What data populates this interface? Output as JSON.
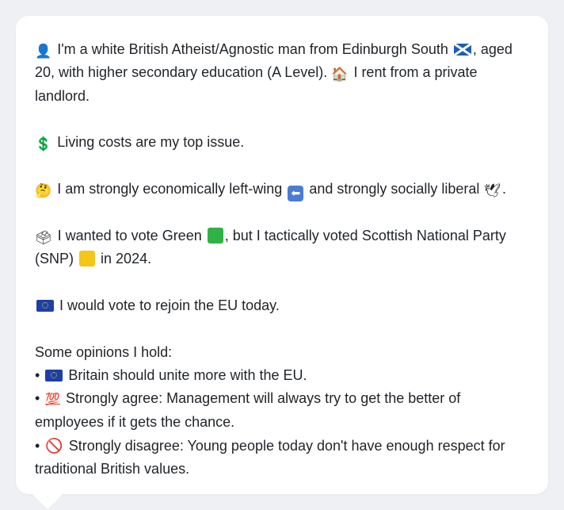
{
  "profile": {
    "intro": {
      "line1_a": "I'm a white British Atheist/Agnostic man from Edinburgh South",
      "line1_b": ", aged 20, with higher secondary education (A Level).",
      "line1_c": "I rent from a private landlord."
    },
    "issue": "Living costs are my top issue.",
    "position_a": "I am strongly economically left-wing",
    "position_b": "and strongly socially liberal",
    "position_c": ".",
    "vote_a": "I wanted to vote Green",
    "vote_b": ", but I tactically voted Scottish National Party (SNP)",
    "vote_c": "in 2024.",
    "eu": "I would vote to rejoin the EU today.",
    "opinions_heading": "Some opinions I hold:",
    "opinions": [
      {
        "bullet": "•",
        "text": "Britain should unite more with the EU."
      },
      {
        "bullet": "•",
        "text": "Strongly agree: Management will always try to get the better of employees if it gets the chance."
      },
      {
        "bullet": "•",
        "text": "Strongly disagree: Young people today don't have enough respect for traditional British values."
      }
    ]
  },
  "icons": {
    "person": "👤",
    "house": "🏠",
    "dollar": "💲",
    "thinking": "🤔",
    "left_arrow": "⬅",
    "dove": "🕊",
    "ballot": "🗳",
    "hundred": "💯",
    "no_entry": "🚫"
  },
  "colors": {
    "green_square": "#2fb344",
    "yellow_square": "#f5c518",
    "card_bg": "#ffffff",
    "page_bg": "#eef0f3"
  }
}
